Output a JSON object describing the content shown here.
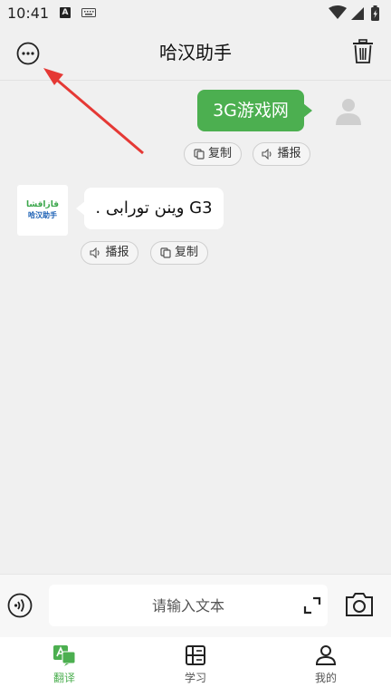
{
  "status": {
    "time": "10:41",
    "notification_letter": "A"
  },
  "header": {
    "title": "哈汉助手"
  },
  "chat": {
    "user_message": {
      "text": "3G游戏网",
      "copy_label": "复制",
      "speak_label": "播报"
    },
    "bot_message": {
      "text": ". وينن تورابى G3",
      "logo_top": "قازاقشا",
      "logo_bottom": "哈汉助手",
      "speak_label": "播报",
      "copy_label": "复制"
    }
  },
  "input": {
    "placeholder": "请输入文本"
  },
  "nav": {
    "items": [
      {
        "label": "翻译",
        "active": true
      },
      {
        "label": "学习",
        "active": false
      },
      {
        "label": "我的",
        "active": false
      }
    ]
  },
  "colors": {
    "accent": "#4caf50",
    "annotation_arrow": "#e53935",
    "nav_active": "#4caf50",
    "nav_inactive": "#555555"
  }
}
